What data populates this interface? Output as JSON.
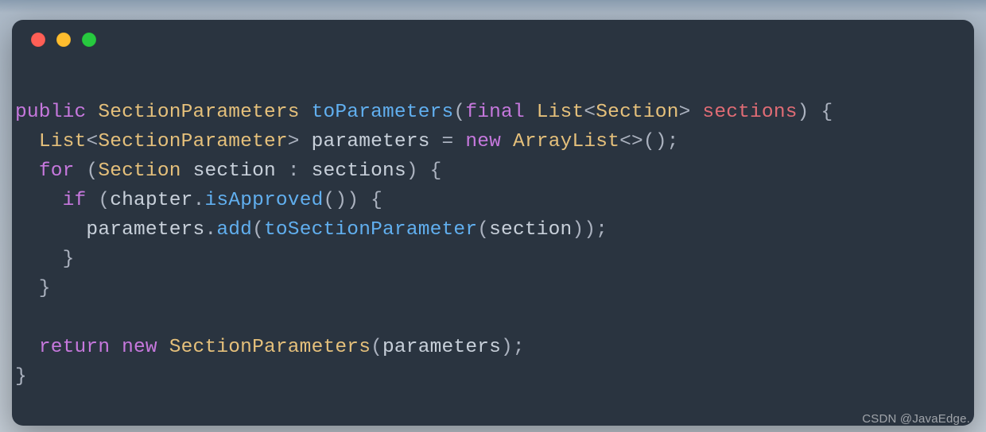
{
  "window": {
    "dots": [
      "close",
      "minimize",
      "zoom"
    ]
  },
  "code": {
    "lines": [
      [
        {
          "cls": "k",
          "t": "public "
        },
        {
          "cls": "t",
          "t": "SectionParameters "
        },
        {
          "cls": "m",
          "t": "toParameters"
        },
        {
          "cls": "p",
          "t": "("
        },
        {
          "cls": "k",
          "t": "final "
        },
        {
          "cls": "t",
          "t": "List"
        },
        {
          "cls": "p",
          "t": "<"
        },
        {
          "cls": "t",
          "t": "Section"
        },
        {
          "cls": "p",
          "t": "> "
        },
        {
          "cls": "id",
          "t": "sections"
        },
        {
          "cls": "p",
          "t": ") {"
        }
      ],
      [
        {
          "cls": "p",
          "t": "  "
        },
        {
          "cls": "t",
          "t": "List"
        },
        {
          "cls": "p",
          "t": "<"
        },
        {
          "cls": "t",
          "t": "SectionParameter"
        },
        {
          "cls": "p",
          "t": "> "
        },
        {
          "cls": "v2",
          "t": "parameters "
        },
        {
          "cls": "p",
          "t": "= "
        },
        {
          "cls": "k",
          "t": "new "
        },
        {
          "cls": "t",
          "t": "ArrayList"
        },
        {
          "cls": "p",
          "t": "<>();"
        }
      ],
      [
        {
          "cls": "p",
          "t": "  "
        },
        {
          "cls": "k",
          "t": "for "
        },
        {
          "cls": "p",
          "t": "("
        },
        {
          "cls": "t",
          "t": "Section "
        },
        {
          "cls": "v2",
          "t": "section "
        },
        {
          "cls": "p",
          "t": ": "
        },
        {
          "cls": "v2",
          "t": "sections"
        },
        {
          "cls": "p",
          "t": ") {"
        }
      ],
      [
        {
          "cls": "p",
          "t": "    "
        },
        {
          "cls": "k",
          "t": "if "
        },
        {
          "cls": "p",
          "t": "("
        },
        {
          "cls": "v2",
          "t": "chapter"
        },
        {
          "cls": "p",
          "t": "."
        },
        {
          "cls": "m",
          "t": "isApproved"
        },
        {
          "cls": "p",
          "t": "()) {"
        }
      ],
      [
        {
          "cls": "p",
          "t": "      "
        },
        {
          "cls": "v2",
          "t": "parameters"
        },
        {
          "cls": "p",
          "t": "."
        },
        {
          "cls": "m",
          "t": "add"
        },
        {
          "cls": "p",
          "t": "("
        },
        {
          "cls": "m",
          "t": "toSectionParameter"
        },
        {
          "cls": "p",
          "t": "("
        },
        {
          "cls": "v2",
          "t": "section"
        },
        {
          "cls": "p",
          "t": "));"
        }
      ],
      [
        {
          "cls": "p",
          "t": "    }"
        }
      ],
      [
        {
          "cls": "p",
          "t": "  }"
        }
      ],
      [
        {
          "cls": "p",
          "t": ""
        }
      ],
      [
        {
          "cls": "p",
          "t": "  "
        },
        {
          "cls": "k",
          "t": "return new "
        },
        {
          "cls": "t",
          "t": "SectionParameters"
        },
        {
          "cls": "p",
          "t": "("
        },
        {
          "cls": "v2",
          "t": "parameters"
        },
        {
          "cls": "p",
          "t": ");"
        }
      ],
      [
        {
          "cls": "p",
          "t": "}"
        }
      ]
    ]
  },
  "watermark": "CSDN @JavaEdge."
}
